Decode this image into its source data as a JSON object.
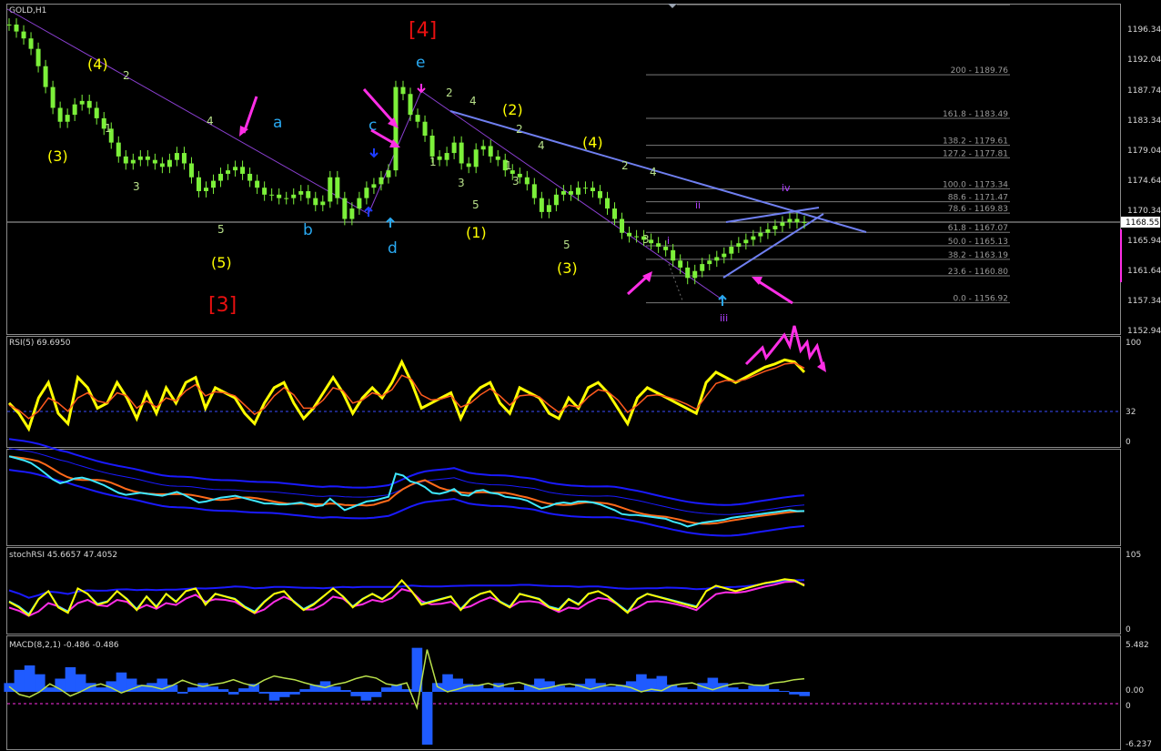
{
  "header": {
    "main_title": "GOLD,H1",
    "rsi_title": "RSI(5) 69.6950",
    "stoch_title": "stochRSI 45.6657 47.4052",
    "macd_title": "MACD(8,2,1) -0.486 -0.486"
  },
  "price_axis": {
    "ticks": [
      "1196.34",
      "1192.04",
      "1187.74",
      "1183.34",
      "1179.04",
      "1174.64",
      "1170.34",
      "1165.94",
      "1161.64",
      "1157.34",
      "1152.94"
    ],
    "current_price": "1168.55"
  },
  "rsi_axis": {
    "ticks": [
      "100",
      "32",
      "0"
    ]
  },
  "stoch_axis": {
    "ticks": [
      "105",
      "0"
    ]
  },
  "macd_axis": {
    "ticks": [
      "5.482",
      "0.00",
      "0",
      "-6.237"
    ]
  },
  "fib_levels": [
    {
      "label": "200 - 1189.76",
      "value": 1189.76
    },
    {
      "label": "161.8 - 1183.49",
      "value": 1183.49
    },
    {
      "label": "138.2 - 1179.61",
      "value": 1179.61
    },
    {
      "label": "127.2 - 1177.81",
      "value": 1177.81
    },
    {
      "label": "100.0 - 1173.34",
      "value": 1173.34
    },
    {
      "label": "88.6 - 1171.47",
      "value": 1171.47
    },
    {
      "label": "78.6 - 1169.83",
      "value": 1169.83
    },
    {
      "label": "61.8 - 1167.07",
      "value": 1167.07
    },
    {
      "label": "50.0 - 1165.13",
      "value": 1165.13
    },
    {
      "label": "38.2 - 1163.19",
      "value": 1163.19
    },
    {
      "label": "23.6 - 1160.80",
      "value": 1160.8
    },
    {
      "label": "0.0 - 1156.92",
      "value": 1156.92
    }
  ],
  "wave_labels": {
    "red": [
      "[4]",
      "[3]"
    ],
    "yellow": [
      "(4)",
      "(3)",
      "(5)",
      "(2)",
      "(1)",
      "(4)",
      "(3)"
    ],
    "blue": [
      "a",
      "b",
      "c",
      "d",
      "e"
    ],
    "green": [
      "2",
      "1",
      "3",
      "4",
      "5",
      "2",
      "4",
      "1",
      "3",
      "5",
      "2",
      "1",
      "3",
      "4",
      "5",
      "3",
      "2",
      "4"
    ],
    "purple": [
      "i",
      "ii",
      "iii",
      "iv"
    ]
  },
  "colors": {
    "background": "#000000",
    "candles": "#7cf03a",
    "rsi_line": "#ffff00",
    "rsi_signal": "#ff5a1e",
    "bands": "#1a1aff",
    "ma_orange": "#ff6a1a",
    "cyan_line": "#3ee8ff",
    "magenta": "#ff2ee6",
    "macd_hist": "#1f5bff",
    "macd_line": "#b9e04a",
    "fib": "#7a7a7a",
    "trend_blue": "#6f7ff0",
    "wave_red": "#e81010",
    "wave_yellow": "#ffff00",
    "wave_blue": "#29a8f0",
    "wave_green": "#b8e08a",
    "wave_purple": "#b040ff"
  },
  "chart_data": {
    "type": "line",
    "symbol": "GOLD",
    "timeframe": "H1",
    "ylim": [
      1152.94,
      1196.34
    ],
    "close": [
      1197.0,
      1196.0,
      1195.0,
      1193.5,
      1191.0,
      1188.0,
      1185.0,
      1183.0,
      1184.0,
      1185.5,
      1186.0,
      1185.0,
      1183.5,
      1182.0,
      1180.0,
      1178.0,
      1177.0,
      1177.5,
      1178.0,
      1177.5,
      1177.0,
      1176.5,
      1177.5,
      1178.5,
      1177.0,
      1175.0,
      1173.0,
      1173.5,
      1174.5,
      1175.5,
      1176.0,
      1176.5,
      1175.5,
      1174.5,
      1173.5,
      1172.5,
      1172.5,
      1172.0,
      1172.0,
      1172.5,
      1173.0,
      1172.0,
      1171.0,
      1171.5,
      1175.0,
      1172.0,
      1169.0,
      1170.5,
      1172.0,
      1173.5,
      1174.0,
      1175.0,
      1176.0,
      1188.0,
      1187.0,
      1184.0,
      1183.0,
      1181.0,
      1178.0,
      1177.5,
      1178.5,
      1180.0,
      1177.0,
      1176.5,
      1179.0,
      1179.5,
      1178.0,
      1177.5,
      1176.0,
      1175.5,
      1175.0,
      1174.0,
      1172.0,
      1170.0,
      1171.0,
      1172.5,
      1173.0,
      1172.5,
      1173.5,
      1173.5,
      1173.0,
      1172.0,
      1170.5,
      1169.0,
      1167.0,
      1166.5,
      1166.5,
      1166.0,
      1165.5,
      1165.0,
      1164.5,
      1163.0,
      1162.0,
      1160.5,
      1161.5,
      1162.5,
      1163.0,
      1163.5,
      1164.0,
      1165.0,
      1165.5,
      1166.0,
      1166.5,
      1167.0,
      1167.5,
      1168.0,
      1168.5,
      1169.0,
      1168.5,
      1168.55
    ],
    "rsi": [
      40,
      30,
      15,
      45,
      60,
      30,
      20,
      65,
      55,
      35,
      40,
      60,
      45,
      25,
      50,
      30,
      55,
      40,
      60,
      65,
      35,
      55,
      50,
      45,
      30,
      20,
      40,
      55,
      60,
      40,
      25,
      35,
      50,
      65,
      50,
      30,
      45,
      55,
      45,
      60,
      80,
      60,
      35,
      40,
      45,
      50,
      25,
      45,
      55,
      60,
      40,
      30,
      55,
      50,
      45,
      30,
      25,
      45,
      35,
      55,
      60,
      50,
      35,
      20,
      45,
      55,
      50,
      45,
      40,
      35,
      30,
      60,
      70,
      65,
      60,
      65,
      70,
      75,
      78,
      82,
      80,
      70
    ],
    "rsi_signal": [
      38,
      33,
      25,
      32,
      45,
      40,
      32,
      45,
      50,
      42,
      40,
      50,
      47,
      35,
      42,
      36,
      45,
      42,
      52,
      58,
      47,
      51,
      50,
      47,
      38,
      29,
      35,
      47,
      55,
      48,
      35,
      35,
      43,
      55,
      52,
      40,
      43,
      50,
      47,
      53,
      67,
      63,
      48,
      43,
      44,
      47,
      36,
      40,
      48,
      54,
      47,
      38,
      47,
      48,
      46,
      38,
      31,
      38,
      36,
      46,
      53,
      51,
      43,
      31,
      38,
      47,
      48,
      46,
      43,
      39,
      34,
      47,
      59,
      62,
      61,
      63,
      67,
      71,
      74,
      78,
      79,
      74
    ],
    "macd": [
      1.0,
      2.5,
      3.0,
      2.0,
      0.5,
      1.5,
      2.8,
      2.0,
      1.0,
      0.5,
      1.2,
      2.2,
      1.5,
      0.8,
      1.0,
      1.5,
      0.8,
      -0.2,
      0.5,
      1.0,
      0.6,
      0.3,
      -0.3,
      0.4,
      0.9,
      -0.2,
      -1.0,
      -0.6,
      -0.3,
      0.3,
      0.8,
      1.2,
      0.6,
      0.2,
      -0.5,
      -1.0,
      -0.6,
      0.5,
      0.8,
      0.3,
      5.0,
      -6.0,
      1.0,
      2.0,
      1.5,
      0.9,
      0.8,
      0.4,
      1.0,
      0.5,
      0.2,
      0.8,
      1.5,
      1.2,
      0.7,
      0.5,
      0.9,
      1.5,
      1.0,
      0.6,
      0.8,
      1.2,
      2.0,
      1.5,
      1.8,
      0.8,
      0.5,
      0.3,
      1.0,
      1.6,
      1.0,
      0.5,
      0.3,
      0.7,
      0.8,
      0.3,
      0.1,
      -0.3,
      -0.486
    ]
  }
}
